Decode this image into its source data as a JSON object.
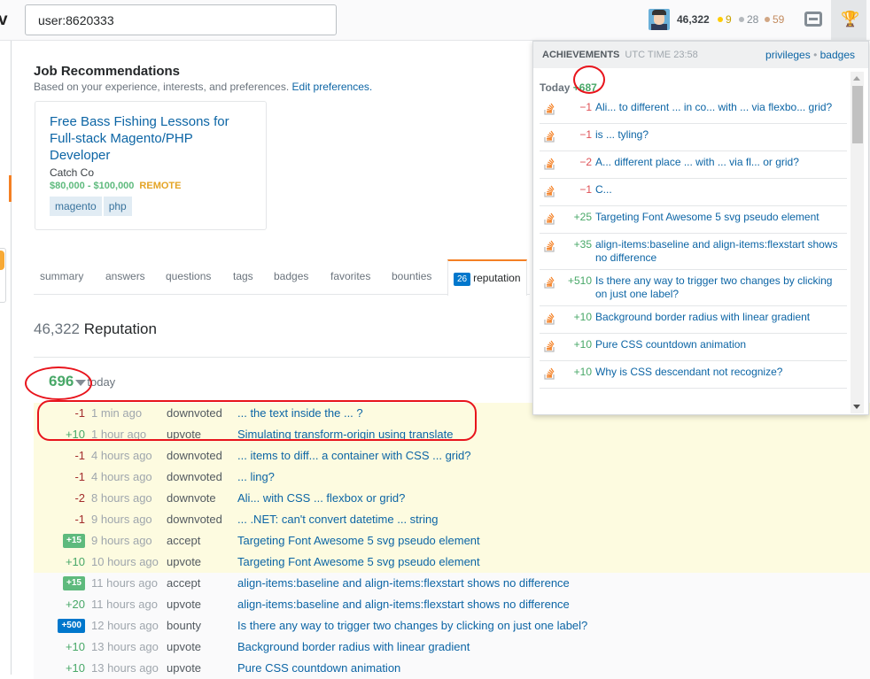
{
  "topbar": {
    "logo_fragment": "v",
    "search_value": "user:8620333",
    "reputation": "46,322",
    "badges": {
      "gold": "9",
      "silver": "28",
      "bronze": "59"
    },
    "colors": {
      "gold": "#ffcc01",
      "silver": "#b4b8bc",
      "bronze": "#d1a684"
    },
    "icons": [
      "inbox-icon",
      "trophy-icon"
    ]
  },
  "jobs": {
    "title": "Job Recommendations",
    "subtitle": "Based on your experience, interests, and preferences.",
    "edit_link": "Edit preferences.",
    "card": {
      "title": "Free Bass Fishing Lessons for Full-stack Magento/PHP Developer",
      "company": "Catch Co",
      "salary": "$80,000 - $100,000",
      "remote": "REMOTE",
      "tags": [
        "magento",
        "php"
      ]
    }
  },
  "tabs": [
    {
      "label": "summary"
    },
    {
      "label": "answers"
    },
    {
      "label": "questions"
    },
    {
      "label": "tags"
    },
    {
      "label": "badges"
    },
    {
      "label": "favorites"
    },
    {
      "label": "bounties"
    },
    {
      "label": "reputation",
      "count": "26",
      "active": true
    }
  ],
  "reputation": {
    "total": "46,322",
    "label": "Reputation",
    "today_value": "696",
    "today_label": "today"
  },
  "rows": [
    {
      "amount": "-1",
      "time": "1 min ago",
      "type": "downvoted",
      "title": "... the text inside the ... ?",
      "bg": "y",
      "kind": "neg"
    },
    {
      "amount": "+10",
      "time": "1 hour ago",
      "type": "upvote",
      "title": "Simulating transform-origin using translate",
      "bg": "y",
      "kind": "pos"
    },
    {
      "amount": "-1",
      "time": "4 hours ago",
      "type": "downvoted",
      "title": "... items to diff... a container with CSS ... grid?",
      "bg": "y",
      "kind": "neg"
    },
    {
      "amount": "-1",
      "time": "4 hours ago",
      "type": "downvoted",
      "title": "... ling?",
      "bg": "y",
      "kind": "neg"
    },
    {
      "amount": "-2",
      "time": "8 hours ago",
      "type": "downvote",
      "title": "Ali... with CSS ... flexbox or grid?",
      "bg": "y",
      "kind": "neg"
    },
    {
      "amount": "-1",
      "time": "9 hours ago",
      "type": "downvoted",
      "title": "... .NET: can't convert datetime ... string",
      "bg": "y",
      "kind": "neg"
    },
    {
      "amount": "+15",
      "time": "9 hours ago",
      "type": "accept",
      "title": "Targeting Font Awesome 5 svg pseudo element",
      "bg": "y",
      "kind": "accept"
    },
    {
      "amount": "+10",
      "time": "10 hours ago",
      "type": "upvote",
      "title": "Targeting Font Awesome 5 svg pseudo element",
      "bg": "y",
      "kind": "pos"
    },
    {
      "amount": "+15",
      "time": "11 hours ago",
      "type": "accept",
      "title": "align-items:baseline and align-items:flexstart shows no difference",
      "bg": "g",
      "kind": "accept"
    },
    {
      "amount": "+20",
      "time": "11 hours ago",
      "type": "upvote",
      "title": "align-items:baseline and align-items:flexstart shows no difference",
      "bg": "g",
      "kind": "pos"
    },
    {
      "amount": "+500",
      "time": "12 hours ago",
      "type": "bounty",
      "title": "Is there any way to trigger two changes by clicking on just one label?",
      "bg": "g",
      "kind": "bounty"
    },
    {
      "amount": "+10",
      "time": "13 hours ago",
      "type": "upvote",
      "title": "Background border radius with linear gradient",
      "bg": "g",
      "kind": "pos"
    },
    {
      "amount": "+10",
      "time": "13 hours ago",
      "type": "upvote",
      "title": "Pure CSS countdown animation",
      "bg": "g",
      "kind": "pos"
    }
  ],
  "achievements": {
    "title": "ACHIEVEMENTS",
    "utc": "UTC TIME 23:58",
    "privileges": "privileges",
    "sep": "•",
    "badges": "badges",
    "today_label": "Today",
    "today_value": "+687",
    "items": [
      {
        "amount": "−1",
        "title": "Ali... to different ... in co... with ... via flexbo... grid?",
        "kind": "neg"
      },
      {
        "amount": "−1",
        "title": "is ... tyling?",
        "kind": "neg"
      },
      {
        "amount": "−2",
        "title": "A... different place ... with ... via fl... or grid?",
        "kind": "neg"
      },
      {
        "amount": "−1",
        "title": "C...",
        "kind": "neg"
      },
      {
        "amount": "+25",
        "title": "Targeting Font Awesome 5 svg pseudo element",
        "kind": "pos"
      },
      {
        "amount": "+35",
        "title": "align-items:baseline and align-items:flexstart shows no difference",
        "kind": "pos"
      },
      {
        "amount": "+510",
        "title": "Is there any way to trigger two changes by clicking on just one label?",
        "kind": "pos"
      },
      {
        "amount": "+10",
        "title": "Background border radius with linear gradient",
        "kind": "pos"
      },
      {
        "amount": "+10",
        "title": "Pure CSS countdown animation",
        "kind": "pos"
      },
      {
        "amount": "+10",
        "title": "Why is CSS descendant not recognize?",
        "kind": "pos"
      }
    ]
  },
  "right_fragment": "ɔ"
}
